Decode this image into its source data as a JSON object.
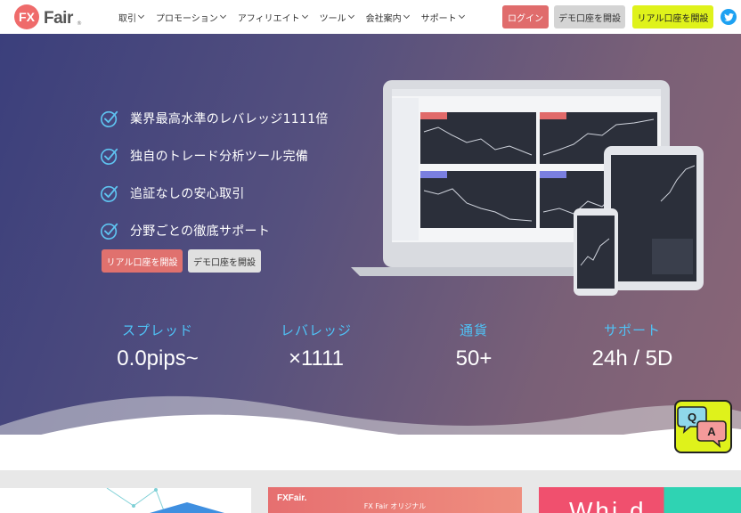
{
  "header": {
    "logo": {
      "fx": "FX",
      "fair": "Fair",
      "reg": "®"
    },
    "nav": [
      {
        "label": "取引"
      },
      {
        "label": "プロモーション"
      },
      {
        "label": "アフィリエイト"
      },
      {
        "label": "ツール"
      },
      {
        "label": "会社案内"
      },
      {
        "label": "サポート"
      }
    ],
    "login_label": "ログイン",
    "demo_label": "デモ口座を開設",
    "real_label": "リアル口座を開設",
    "twitter_icon": "twitter-icon"
  },
  "hero": {
    "features": [
      "業界最高水準のレバレッジ1111倍",
      "独自のトレード分析ツール完備",
      "追証なしの安心取引",
      "分野ごとの徹底サポート"
    ],
    "cta_real": "リアル口座を開設",
    "cta_demo": "デモ口座を開設",
    "stats": [
      {
        "label": "スプレッド",
        "value": "0.0pips~"
      },
      {
        "label": "レバレッジ",
        "value": "×1111"
      },
      {
        "label": "通貨",
        "value": "50+"
      },
      {
        "label": "サポート",
        "value": "24h / 5D"
      }
    ]
  },
  "qa_badge": {
    "q": "Q",
    "a": "A"
  },
  "cards": {
    "card2_logo": "FXFair.",
    "card2_title": "FX Fair オリジナル",
    "card3_text": "Whi d"
  },
  "colors": {
    "accent_red": "#e06c6c",
    "accent_lime": "#dff21b",
    "stat_label": "#4fc3f7",
    "check": "#5fc3f0"
  }
}
